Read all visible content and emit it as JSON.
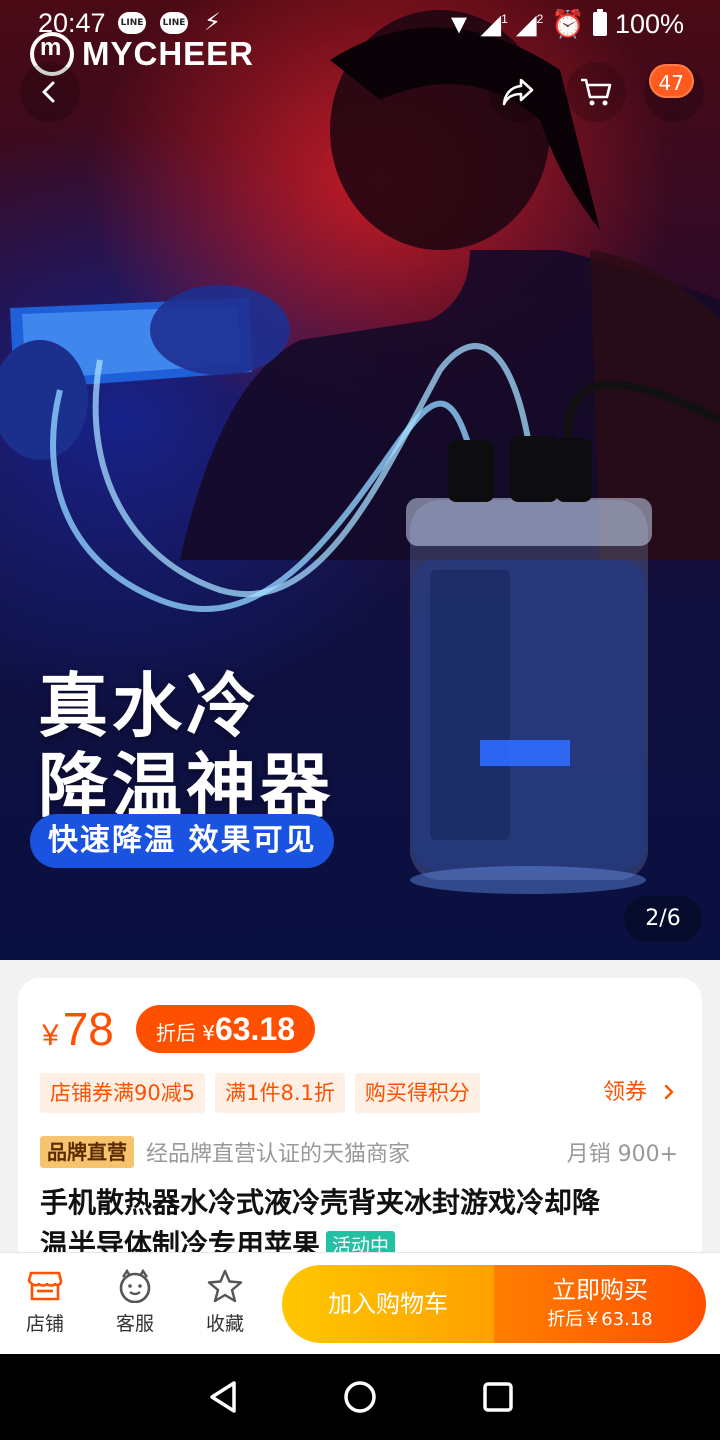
{
  "status_bar": {
    "time": "20:47",
    "line_badge": "LINE",
    "signal_sim1": "1",
    "signal_sim2": "2",
    "battery": "100%"
  },
  "hero": {
    "brand_name": "MYCHEER",
    "cart_count": "47",
    "slogan_line1": "真水冷",
    "slogan_line2": "降温神器",
    "slogan_pill": "快速降温 效果可见",
    "page_indicator": "2/6"
  },
  "product": {
    "currency": "¥",
    "price": "78",
    "discount_label": "折后",
    "discount_currency": "¥",
    "discount_price": "63.18",
    "tags": [
      "店铺券满90减5",
      "满1件8.1折",
      "购买得积分"
    ],
    "coupon_link": "领券",
    "brand_badge": "品牌直营",
    "brand_text": "经品牌直营认证的天猫商家",
    "monthly_sales": "月销 900+",
    "title_line1": "手机散热器水冷式液冷壳背夹冰封游戏冷却降",
    "title_line2": "温半导体制冷专用苹果",
    "activity_badge": "活动中"
  },
  "actions": {
    "store": "店铺",
    "service": "客服",
    "favorite": "收藏",
    "add_to_cart": "加入购物车",
    "buy_now": "立即购买",
    "buy_now_sub": "折后￥63.18"
  },
  "colors": {
    "accent": "#ff4f00",
    "cart_button": "#ffb300",
    "activity_badge": "#22c1a4",
    "brand_badge": "#f7c36e"
  },
  "icons": {
    "back": "chevron-left-icon",
    "share": "share-arrow-icon",
    "cart": "cart-icon",
    "store": "store-icon",
    "service": "smiley-chat-icon",
    "favorite": "star-icon",
    "coupon": "chevron-right-icon"
  }
}
